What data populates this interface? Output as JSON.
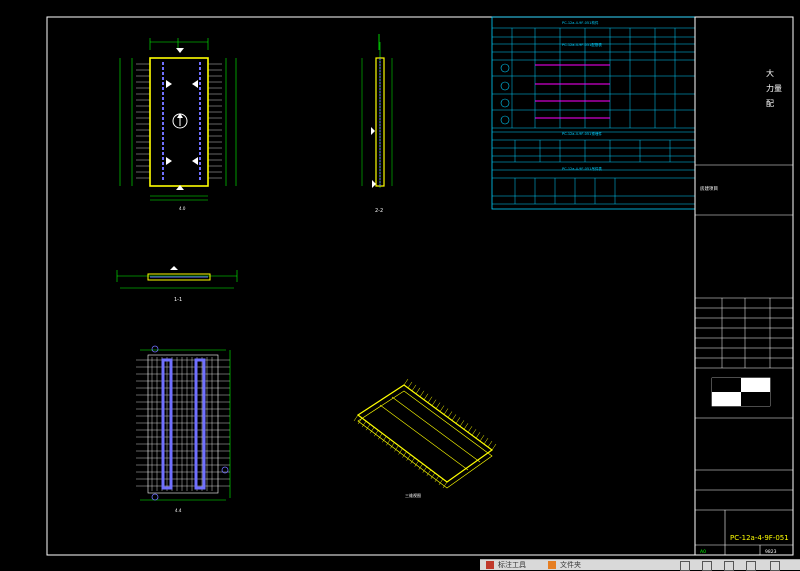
{
  "title_block": {
    "company_chars": [
      "大",
      "力量",
      "配"
    ],
    "project_label": "房建项目",
    "drawing_no": "PC-12a-4-9F-051",
    "sheet_no": "9823",
    "revision_label": "A0",
    "page_number": "A2"
  },
  "views": {
    "plan_label": "4.0",
    "section_label_2": "2-2",
    "section_label_1": "1-1",
    "iso_label": "三维视图",
    "rebar_label": "4.4"
  },
  "table": {
    "title_1": "PC-12a-4-9F-051构件",
    "title_2": "PC-12a-4-9F-051配筋表",
    "title_3": "PC-12a-4-9F-051预埋件",
    "title_4": "PC-12a-4-9F-051吊件表"
  },
  "taskbar": {
    "item1": "标注工具",
    "item2": "文件夹"
  },
  "colors": {
    "background": "#000000",
    "frame": "#ffffff",
    "table": "#00d0ff",
    "rebar": "#7070ff",
    "outline": "#ffff00",
    "dimension": "#00ff00",
    "highlight": "#ff00ff"
  }
}
